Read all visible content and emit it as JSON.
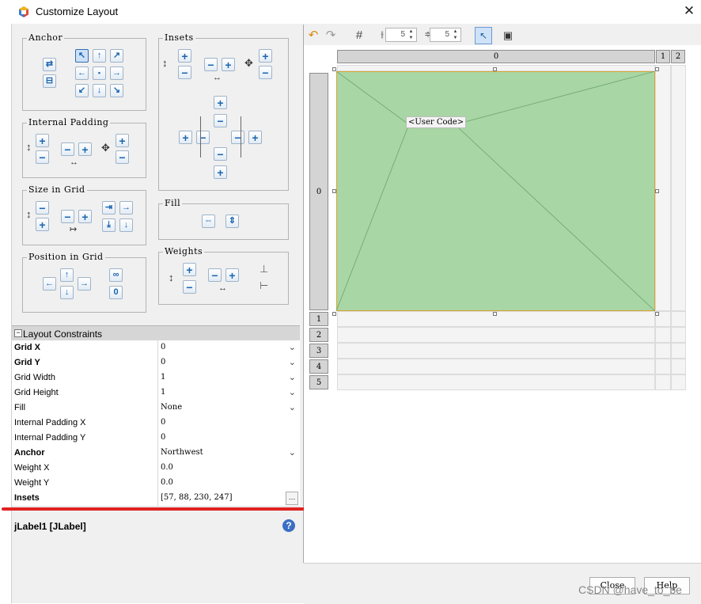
{
  "window": {
    "title": "Customize Layout",
    "close": "✕"
  },
  "groups": {
    "anchor": "Anchor",
    "insets": "Insets",
    "internal_padding": "Internal Padding",
    "size_in_grid": "Size in Grid",
    "fill": "Fill",
    "position_in_grid": "Position in Grid",
    "weights": "Weights"
  },
  "properties": {
    "header": "Layout Constraints",
    "rows": [
      {
        "name": "Grid X",
        "value": "0",
        "bold": true,
        "control": "dropdown"
      },
      {
        "name": "Grid Y",
        "value": "0",
        "bold": true,
        "control": "dropdown"
      },
      {
        "name": "Grid Width",
        "value": "1",
        "bold": false,
        "control": "dropdown"
      },
      {
        "name": "Grid Height",
        "value": "1",
        "bold": false,
        "control": "dropdown"
      },
      {
        "name": "Fill",
        "value": "None",
        "bold": false,
        "control": "dropdown"
      },
      {
        "name": "Internal Padding X",
        "value": "0",
        "bold": false,
        "control": "text"
      },
      {
        "name": "Internal Padding Y",
        "value": "0",
        "bold": false,
        "control": "text"
      },
      {
        "name": "Anchor",
        "value": "Northwest",
        "bold": true,
        "control": "dropdown"
      },
      {
        "name": "Weight X",
        "value": "0.0",
        "bold": false,
        "control": "text"
      },
      {
        "name": "Weight Y",
        "value": "0.0",
        "bold": false,
        "control": "text"
      },
      {
        "name": "Insets",
        "value": "[57, 88, 230, 247]",
        "bold": true,
        "control": "ellipsis"
      }
    ]
  },
  "selected_component": "jLabel1 [JLabel]",
  "toolbar": {
    "hgap": "5",
    "vgap": "5"
  },
  "grid": {
    "columns": [
      "0",
      "1",
      "2"
    ],
    "rows": [
      "0",
      "1",
      "2",
      "3",
      "4",
      "5"
    ],
    "component_label": "<User Code>"
  },
  "buttons": {
    "close": "Close",
    "help": "Help"
  },
  "watermark": "CSDN @have_to_be",
  "colors": {
    "component_fill": "#a9d6a5",
    "component_border": "#d8a62e",
    "annotation": "#e12222"
  }
}
